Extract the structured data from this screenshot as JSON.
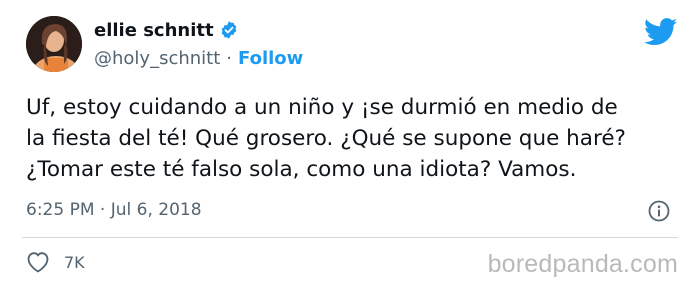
{
  "tweet": {
    "author": {
      "display_name": "ellie schnitt",
      "handle": "@holy_schnitt",
      "verified": true,
      "follow_label": "Follow",
      "separator": "·"
    },
    "text": "Uf, estoy cuidando a un niño y ¡se durmió en medio de\nla fiesta del té! Qué grosero. ¿Qué se supone que haré?\n¿Tomar este té falso sola, como una idiota? Vamos.",
    "timestamp": "6:25 PM · Jul 6, 2018",
    "likes": "7K"
  },
  "icons": {
    "verified": "verified-badge-icon",
    "brand": "twitter-bird-icon",
    "info": "info-icon",
    "like": "heart-icon"
  },
  "colors": {
    "accent": "#1d9bf0",
    "text": "#0f1419",
    "secondary": "#536471",
    "divider": "#cfd9de"
  },
  "watermark": "boredpanda.com"
}
